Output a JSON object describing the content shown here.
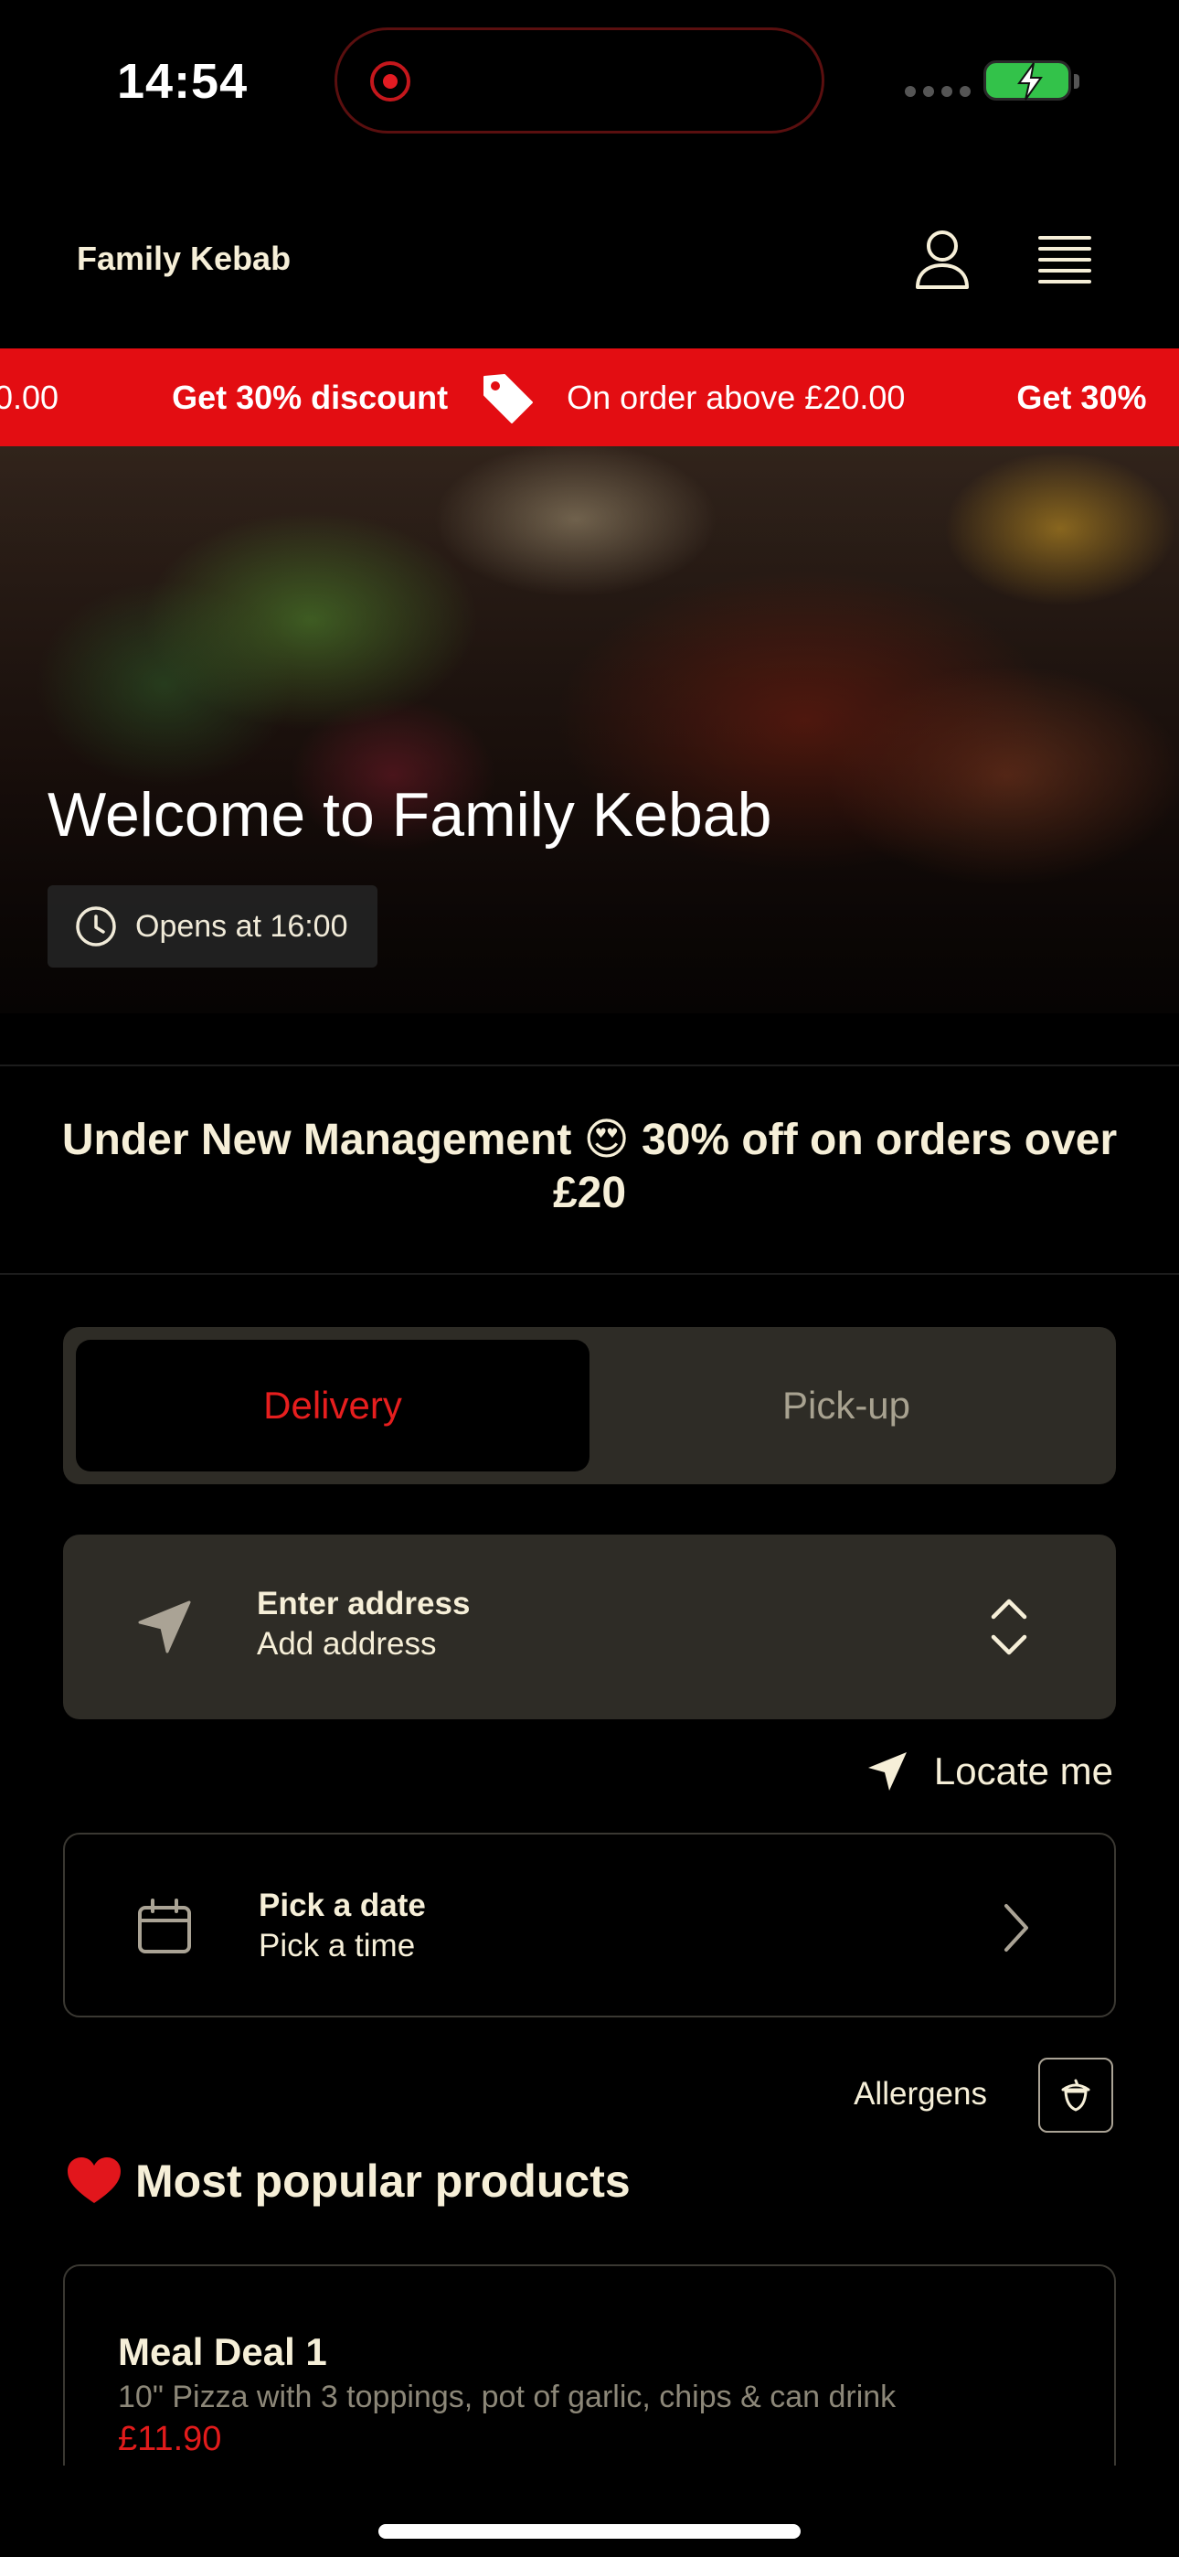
{
  "status_bar": {
    "time": "14:54"
  },
  "header": {
    "brand": "Family Kebab",
    "icons": [
      "user-icon",
      "menu-icon"
    ]
  },
  "promo": {
    "lead_fragment": "0.00",
    "discount_label": "Get 30% discount",
    "condition_label": "On order above £20.00",
    "trail_fragment": "Get 30%",
    "background_color": "#e30d12"
  },
  "hero": {
    "title": "Welcome to Family Kebab",
    "hours": "Opens at 16:00"
  },
  "announcement": {
    "line1": "Under New Management 😍 30% off on orders over",
    "line2": "£20"
  },
  "fulfilment": {
    "options": [
      "Delivery",
      "Pick-up"
    ],
    "selected": "Delivery",
    "accent_color": "#e61e1e"
  },
  "address": {
    "title": "Enter address",
    "subtitle": "Add address"
  },
  "locate": {
    "label": "Locate me"
  },
  "schedule": {
    "date_label": "Pick a date",
    "time_label": "Pick a time"
  },
  "allergens": {
    "label": "Allergens"
  },
  "popular": {
    "title": "Most popular products",
    "products": [
      {
        "name": "Meal Deal 1",
        "description": "10\" Pizza with 3 toppings, pot of garlic, chips & can drink",
        "price": "£11.90"
      }
    ]
  }
}
